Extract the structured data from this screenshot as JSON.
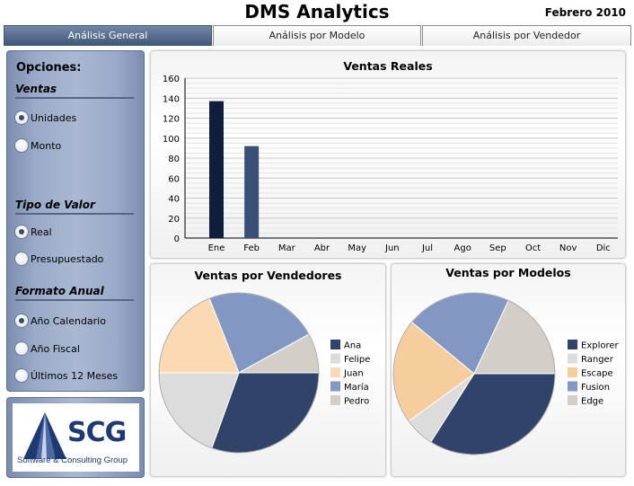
{
  "header": {
    "title": "DMS Analytics",
    "period": "Febrero 2010"
  },
  "tabs": [
    {
      "label": "Análisis General",
      "active": true
    },
    {
      "label": "Análisis por Modelo",
      "active": false
    },
    {
      "label": "Análisis por Vendedor",
      "active": false
    }
  ],
  "options": {
    "title": "Opciones:",
    "groups": [
      {
        "heading": "Ventas",
        "items": [
          {
            "label": "Unidades",
            "checked": true
          },
          {
            "label": "Monto",
            "checked": false
          }
        ]
      },
      {
        "heading": "Tipo de  Valor",
        "items": [
          {
            "label": "Real",
            "checked": true
          },
          {
            "label": "Presupuestado",
            "checked": false
          }
        ]
      },
      {
        "heading": "Formato Anual",
        "items": [
          {
            "label": "Año Calendario",
            "checked": true
          },
          {
            "label": "Año Fiscal",
            "checked": false
          },
          {
            "label": "Últimos 12 Meses",
            "checked": false
          }
        ]
      }
    ]
  },
  "logo": {
    "text": "SCG",
    "subtitle": "Software & Consulting Group"
  },
  "colors": {
    "accent": "#3f5677",
    "tab_active": "#566b8e"
  },
  "chart_data": [
    {
      "type": "bar",
      "title": "Ventas Reales",
      "categories": [
        "Ene",
        "Feb",
        "Mar",
        "Abr",
        "May",
        "Jun",
        "Jul",
        "Ago",
        "Sep",
        "Oct",
        "Nov",
        "Dic"
      ],
      "values": [
        137,
        92,
        0,
        0,
        0,
        0,
        0,
        0,
        0,
        0,
        0,
        0
      ],
      "bar_colors": [
        "#0f1e3a",
        "#3a4f75"
      ],
      "ylim": [
        0,
        160
      ],
      "yticks": [
        0,
        20,
        40,
        60,
        80,
        100,
        120,
        140,
        160
      ],
      "grid": true
    },
    {
      "type": "pie",
      "title": "Ventas por Vendedores",
      "labels": [
        "Ana",
        "Felipe",
        "Juan",
        "María",
        "Pedro"
      ],
      "values": [
        30.5,
        19.5,
        19,
        23,
        8
      ],
      "colors": [
        "#2f4468",
        "#dcdcdc",
        "#fbd9b2",
        "#8298c2",
        "#d3cec7"
      ],
      "legend": "right"
    },
    {
      "type": "pie",
      "title": "Ventas por Modelos",
      "labels": [
        "Explorer",
        "Ranger",
        "Escape",
        "Fusion",
        "Edge"
      ],
      "values": [
        34,
        6,
        21,
        21,
        18
      ],
      "colors": [
        "#2f4468",
        "#dcdcdc",
        "#f6cd9c",
        "#8298c2",
        "#d3cec7"
      ],
      "legend": "right"
    }
  ]
}
